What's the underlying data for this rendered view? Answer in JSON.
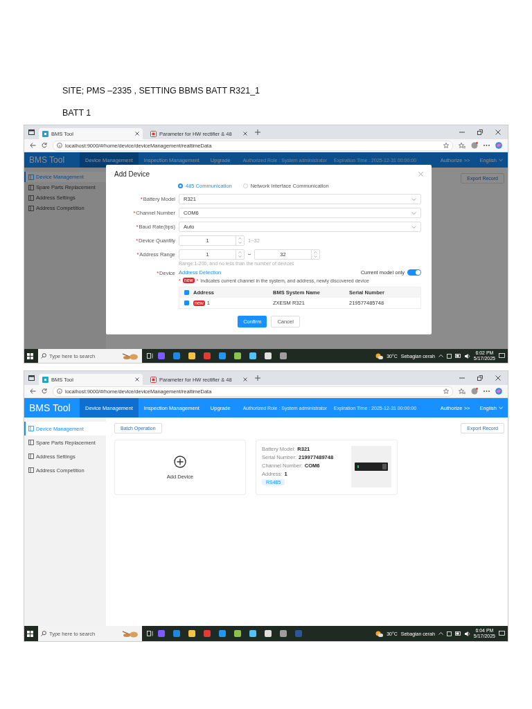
{
  "document": {
    "heading": "SITE; PMS –2335 , SETTING BBMS BATT R321_1",
    "subheading": "BATT 1"
  },
  "screenshots": [
    {
      "browser": {
        "tabs": [
          {
            "kind": "page",
            "title": "BMS Tool",
            "selected": true
          },
          {
            "kind": "pdf",
            "title": "Parameter for HW rectifier & 48",
            "selected": false
          }
        ],
        "url": "localhost:9000/#/home/device/deviceManagement/realtimeData"
      },
      "app": {
        "title": "BMS Tool",
        "nav": [
          {
            "label": "Device Management",
            "selected": true
          },
          {
            "label": "Inspection Management",
            "selected": false
          },
          {
            "label": "Upgrade",
            "selected": false
          }
        ],
        "role": "Authorized Role : System administrator",
        "expiration": "Expiration Time : 2025-12-31 00:00:00",
        "authorize": "Authorize >>",
        "language": "English"
      },
      "sidebar": [
        {
          "label": "Device Management",
          "selected": true
        },
        {
          "label": "Spare Parts Replacement",
          "selected": false
        },
        {
          "label": "Address Settings",
          "selected": false
        },
        {
          "label": "Address Competition",
          "selected": false
        }
      ],
      "toolbar": {
        "export": "Export Record"
      },
      "dialog": {
        "title": "Add Device",
        "radios": [
          {
            "label": "485 Communication",
            "selected": true
          },
          {
            "label": "Network Interface Communication",
            "selected": false
          }
        ],
        "fields": [
          {
            "kind": "select",
            "mark": "*",
            "label": "Battery Model",
            "value": "R321"
          },
          {
            "kind": "select",
            "mark": "*",
            "label": "Channel Number",
            "value": "COM6"
          },
          {
            "kind": "select",
            "mark": "*",
            "label": "Baud Rate(bps)",
            "value": "Auto"
          },
          {
            "kind": "number",
            "mark": "*",
            "label": "Device Quantity",
            "value": "1",
            "hint": "1~32"
          },
          {
            "kind": "range",
            "mark": "*",
            "label": "Address Range",
            "from": "1",
            "to": "32",
            "help": "Range:1-200, and no less than the number of devices"
          }
        ],
        "device": {
          "mark": "*",
          "label": "Device",
          "link": "Address Detection",
          "toggle_label": "Current model only",
          "toggle_on": true,
          "legend": {
            "mark_before": "*",
            "badge": "new",
            "mark_after": "*",
            "text": "Indicates current channel in the system, and address, newly discovered device"
          },
          "columns": [
            "Address",
            "BMS System Name",
            "Serial Number"
          ],
          "all_checked": true,
          "rows": [
            {
              "checked": true,
              "badge": "new",
              "address": "1",
              "name": "ZXESM R321",
              "serial": "219577485748"
            }
          ]
        },
        "buttons": {
          "confirm": "Confirm",
          "cancel": "Cancel"
        }
      },
      "taskbar": {
        "search": "Type here to search",
        "temperature": "30°C",
        "weather": "Sebagian cerah",
        "time": "6:02 PM",
        "date": "5/17/2025"
      }
    },
    {
      "browser": {
        "tabs": [
          {
            "kind": "page",
            "title": "BMS Tool",
            "selected": true
          },
          {
            "kind": "pdf",
            "title": "Parameter for HW rectifier & 48",
            "selected": false
          }
        ],
        "url": "localhost:9000/#/home/device/deviceManagement/realtimeData"
      },
      "app": {
        "title": "BMS Tool",
        "nav": [
          {
            "label": "Device Management",
            "selected": true
          },
          {
            "label": "Inspection Management",
            "selected": false
          },
          {
            "label": "Upgrade",
            "selected": false
          }
        ],
        "role": "Authorized Role : System administrator",
        "expiration": "Expiration Time : 2025-12-31 00:00:00",
        "authorize": "Authorize >>",
        "language": "English"
      },
      "sidebar": [
        {
          "label": "Device Management",
          "selected": true
        },
        {
          "label": "Spare Parts Replacement",
          "selected": false
        },
        {
          "label": "Address Settings",
          "selected": false
        },
        {
          "label": "Address Competition",
          "selected": false
        }
      ],
      "toolbar": {
        "batch": "Batch Operation",
        "export": "Export Record"
      },
      "cards": {
        "add_label": "Add Device",
        "devices": [
          {
            "lines": [
              {
                "label": "Battery Model:",
                "value": "R321"
              },
              {
                "label": "Serial Number:",
                "value": "219977489748"
              },
              {
                "label": "Channel Number:",
                "value": "COM6"
              },
              {
                "label": "Address:",
                "value": "1"
              }
            ],
            "tag": "RS485"
          }
        ]
      },
      "taskbar": {
        "search": "Type here to search",
        "temperature": "30°C",
        "weather": "Sebagian cerah",
        "time": "6:04 PM",
        "date": "5/17/2025"
      }
    }
  ]
}
